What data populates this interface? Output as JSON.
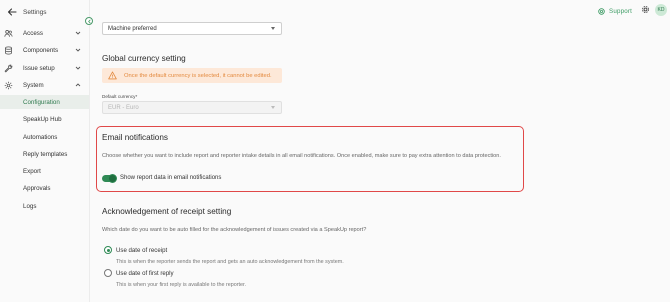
{
  "sidebar": {
    "back_label": "Settings",
    "items": [
      {
        "label": "Access",
        "icon": "users-icon"
      },
      {
        "label": "Components",
        "icon": "database-icon"
      },
      {
        "label": "Issue setup",
        "icon": "wrench-icon"
      },
      {
        "label": "System",
        "icon": "gear-icon"
      }
    ],
    "subitems": [
      {
        "label": "Configuration"
      },
      {
        "label": "SpeakUp Hub"
      },
      {
        "label": "Automations"
      },
      {
        "label": "Reply templates"
      },
      {
        "label": "Export"
      },
      {
        "label": "Approvals"
      },
      {
        "label": "Logs"
      }
    ]
  },
  "header": {
    "support_label": "Support",
    "avatar_initials": "KD"
  },
  "main": {
    "language_select_value": "Machine preferred",
    "currency": {
      "title": "Global currency setting",
      "warning": "Once the default currency is selected, it cannot be edited.",
      "field_label": "Default currency*",
      "field_value": "EUR - Euro"
    },
    "email": {
      "title": "Email notifications",
      "description": "Choose whether you want to include report and reporter intake details in all email notifications. Once enabled, make sure to pay extra attention to data protection.",
      "toggle_label": "Show report data in email notifications",
      "toggle_on": true
    },
    "receipt": {
      "title": "Acknowledgement of receipt setting",
      "question": "Which date do you want to be auto filled for the acknowledgement of issues created via a SpeakUp report?",
      "options": [
        {
          "label": "Use date of receipt",
          "help": "This is when the reporter sends the report and gets an auto acknowledgement from the system.",
          "checked": true
        },
        {
          "label": "Use date of first reply",
          "help": "This is when your first reply is available to the reporter.",
          "checked": false
        }
      ]
    }
  },
  "colors": {
    "accent": "#2f8a55",
    "highlight_border": "#e04848",
    "warning_bg": "#fde8d8",
    "warning_text": "#e38a3f"
  }
}
